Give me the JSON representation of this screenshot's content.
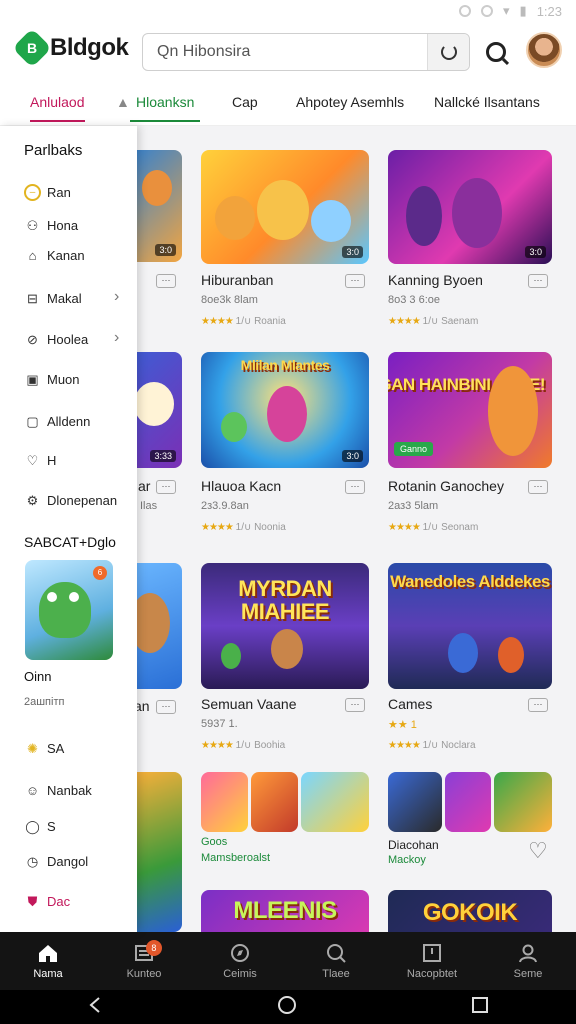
{
  "status": {
    "time": "1:23"
  },
  "header": {
    "logo_text": "Bldgok",
    "logo_mark": "B",
    "search_value": "Qn  Hibonsira"
  },
  "tabs": [
    "Anlulaod",
    "Hloanksn",
    "Cap",
    "Ahpotey Asemhls",
    "Nallcké Ilsantans"
  ],
  "sidebar": {
    "heading1": "Parlbaks",
    "items_top": [
      {
        "label": "Ran",
        "icon": "coin-icon"
      },
      {
        "label": "Hona",
        "icon": "people-icon"
      },
      {
        "label": "Kanan",
        "icon": "tag-icon"
      },
      {
        "label": "Makal",
        "icon": "book-icon",
        "chevron": true
      },
      {
        "label": "Hoolea",
        "icon": "compass-icon",
        "chevron": true
      },
      {
        "label": "Muon",
        "icon": "image-icon"
      },
      {
        "label": "Alldenn",
        "icon": "bookmark-icon"
      },
      {
        "label": "H",
        "icon": "heart-icon"
      },
      {
        "label": "Dlonepenan",
        "icon": "gear-icon"
      }
    ],
    "heading2": "SABCAT+Dglo",
    "featured_title": "Oinn",
    "featured_sub": "2ашпітп",
    "featured_badge": "6",
    "items_bottom": [
      {
        "label": "SA",
        "icon": "sun-icon"
      },
      {
        "label": "Nanbak",
        "icon": "smile-icon"
      },
      {
        "label": "S",
        "icon": "moon-icon"
      },
      {
        "label": "Dangol",
        "icon": "clock-icon"
      },
      {
        "label": "Dac",
        "icon": "shield-icon"
      }
    ]
  },
  "cards": [
    {
      "title": "",
      "sub": "",
      "meta": "",
      "more": "⋯",
      "dur": "3:0"
    },
    {
      "title": "Hiburanban",
      "sub": "8oe3k 8lam",
      "stars": "★★★★",
      "meta": "1/∪   Roania",
      "more": "⋯",
      "dur": "3:0"
    },
    {
      "title": "Kanning Byoen",
      "sub": "8o3 3 6:oe",
      "stars": "★★★★",
      "meta": "1/∪   Saenam",
      "more": "⋯",
      "dur": "3:0"
    },
    {
      "title": "ar",
      "sub": "Ilas",
      "meta": "",
      "more": "⋯",
      "dur": "3:33"
    },
    {
      "title": "Hlauoa Kacn",
      "sub": "2з3.9.8an",
      "stars": "★★★★",
      "meta": "1/∪   Noonia",
      "more": "⋯",
      "dur": "3:0",
      "banner": "Mlilan Mlantes"
    },
    {
      "title": "Rotanin Ganochey",
      "sub": "2аз3 5lam",
      "stars": "★★★★",
      "meta": "1/∪   Seonam",
      "more": "⋯",
      "banner": "ALAGAN HAINBINI JAME!",
      "chip": "Ganno"
    },
    {
      "title": "an",
      "sub": "",
      "meta": "",
      "more": ""
    },
    {
      "title": "Semuan Vaane",
      "sub": "5937 1.",
      "stars": "★★★★",
      "meta": "1/∪   Boohia",
      "more": "⋯",
      "banner": "MYRDAN MIAHIEE"
    },
    {
      "title": "Cames",
      "sub": "★★ 1",
      "stars": "★★★★",
      "meta": "1/∪   Noclara",
      "more": "⋯",
      "banner": "Wanedoles Alddekes"
    },
    {
      "title": "",
      "sub": "",
      "meta": ""
    },
    {
      "title": "Goos",
      "sub": "Mamsberoalst",
      "more": ""
    },
    {
      "title": "Diacohan",
      "sub": "Mackoy",
      "more": ""
    },
    {
      "title": "",
      "banner": "MLEENIS"
    },
    {
      "title": "",
      "banner": "GOKOIK"
    }
  ],
  "bottom_nav": [
    {
      "label": "Nama",
      "icon": "home-icon",
      "active": true
    },
    {
      "label": "Kunteo",
      "icon": "list-icon",
      "badge": "8"
    },
    {
      "label": "Ceimis",
      "icon": "compass-icon"
    },
    {
      "label": "Tlaee",
      "icon": "search-icon"
    },
    {
      "label": "Nacopbtet",
      "icon": "inbox-icon"
    },
    {
      "label": "Seme",
      "icon": "person-icon"
    }
  ],
  "colors": {
    "brand": "#1fa64a",
    "tab_active": "#c2185b",
    "tab_active2": "#1b8a3a",
    "stars": "#e7a813",
    "nav_bg": "#141414"
  }
}
